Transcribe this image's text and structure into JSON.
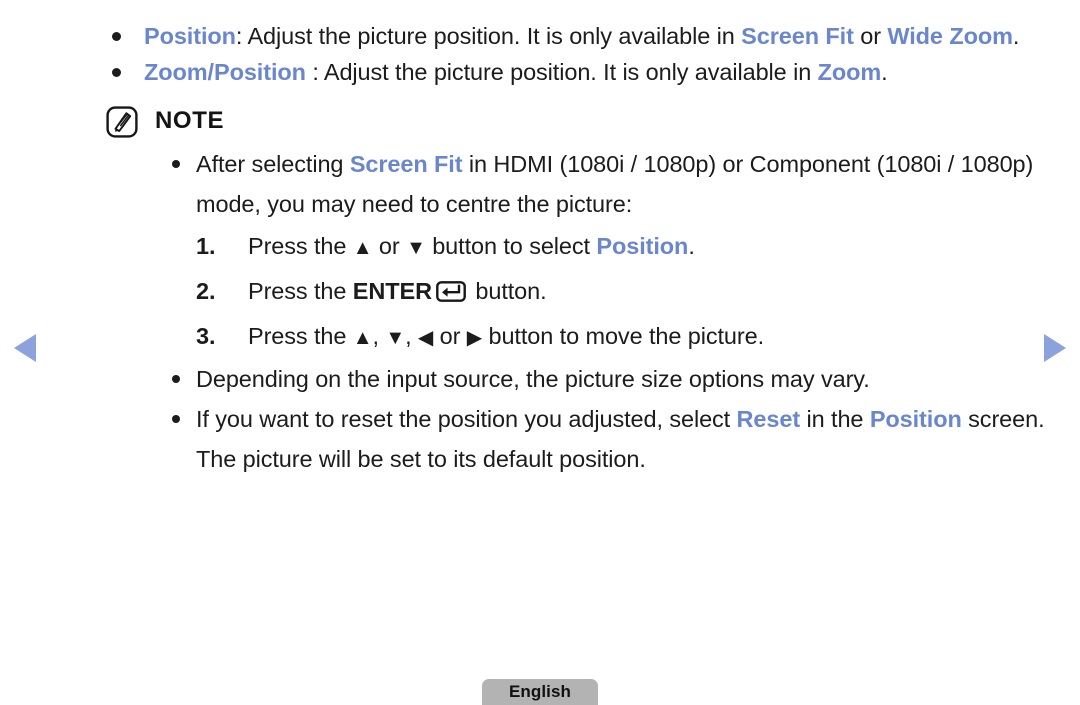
{
  "page": {
    "accent_blue": "#6a86ce",
    "arrow_blue": "#8ca2dc",
    "text_color": "#1c1c1c"
  },
  "nav": {
    "prev_label": "◀",
    "next_label": "▶"
  },
  "bullets": [
    {
      "term": "Position",
      "sep": ": ",
      "text_1": "Adjust the picture position. It is only available in ",
      "em_1": "Screen Fit",
      "text_2": " or ",
      "em_2": "Wide Zoom",
      "text_3": "."
    },
    {
      "term": "Zoom/Position",
      "sep": " : ",
      "text_1": "Adjust the picture position. It is only available in ",
      "em_1": "Zoom",
      "text_2": "."
    }
  ],
  "note": {
    "icon_name": "note-pencil-icon",
    "label": "NOTE",
    "items": [
      {
        "text_1": "After selecting ",
        "em_1": "Screen Fit",
        "text_2": " in HDMI (1080i / 1080p) or Component (1080i / 1080p) mode, you may need to centre the picture:"
      }
    ],
    "steps": [
      {
        "num": "1.",
        "text_1": "Press the ",
        "arrow_1": "▲",
        "text_2": " or ",
        "arrow_2": "▼",
        "text_3": " button to select ",
        "em_1": "Position",
        "text_4": "."
      },
      {
        "num": "2.",
        "text_1": "Press the ",
        "key_label": "ENTER",
        "key_glyph": "enter-return-icon",
        "text_2": " button."
      },
      {
        "num": "3.",
        "text_1": "Press the ",
        "arrow_1": "▲",
        "text_2": ", ",
        "arrow_2": "▼",
        "text_3": ", ",
        "arrow_3": "◀",
        "text_4": " or ",
        "arrow_4": "▶",
        "text_5": " button to move the picture."
      }
    ],
    "items_after": [
      {
        "text_1": "Depending on the input source, the picture size options may vary."
      },
      {
        "text_1": "If you want to reset the position you adjusted, select ",
        "em_1": "Reset",
        "text_2": " in the ",
        "em_2": "Position",
        "text_3": " screen. The picture will be set to its default position."
      }
    ]
  },
  "footer": {
    "language": "English"
  }
}
